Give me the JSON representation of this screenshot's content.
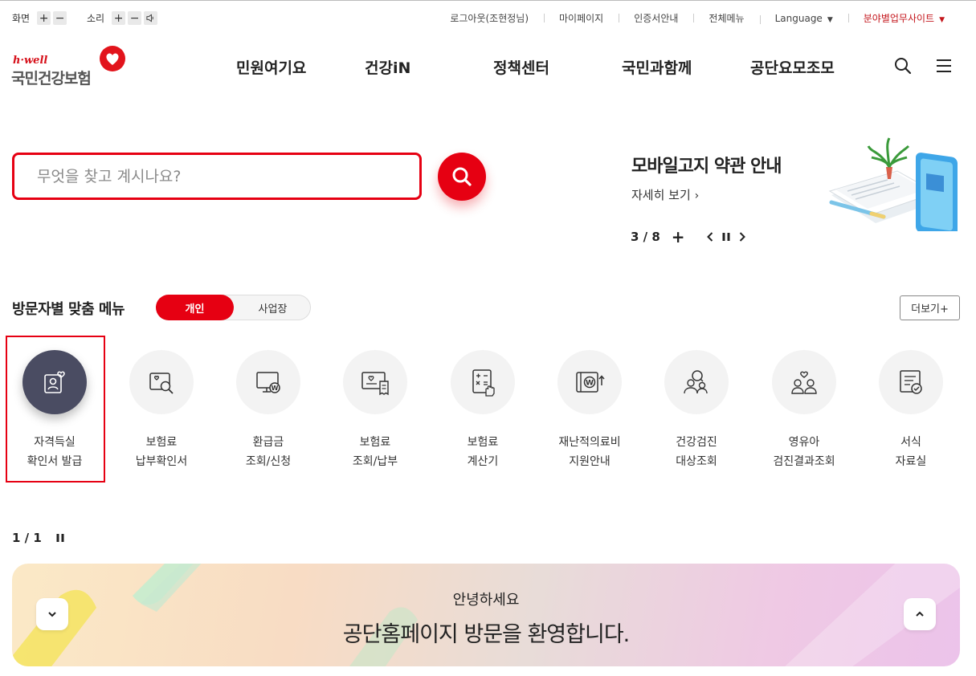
{
  "utility": {
    "screen_label": "화면",
    "sound_label": "소리",
    "plus": "+",
    "minus": "−",
    "links": [
      "로그아웃(조현정님)",
      "마이페이지",
      "인증서안내",
      "전체메뉴"
    ],
    "language": "Language",
    "business_site": "분야별업무사이트"
  },
  "header": {
    "logo_small": "h·well",
    "logo_name": "국민건강보험",
    "nav": [
      "민원여기요",
      "건강iN",
      "정책센터",
      "국민과함께",
      "공단요모조모"
    ],
    "icons": [
      "search-icon",
      "hamburger-menu-icon"
    ]
  },
  "search": {
    "placeholder": "무엇을 찾고 계시나요?"
  },
  "banner": {
    "title": "모바일고지 약관 안내",
    "more": "자세히 보기",
    "page": "3 / 8",
    "plus": "+"
  },
  "visitor_menu": {
    "title": "방문자별 맞춤 메뉴",
    "toggle_on": "개인",
    "toggle_off": "사업장",
    "more": "더보기+",
    "items": [
      {
        "l1": "자격득실",
        "l2": "확인서 발급",
        "icon": "certificate-person-icon"
      },
      {
        "l1": "보험료",
        "l2": "납부확인서",
        "icon": "document-search-icon"
      },
      {
        "l1": "환급금",
        "l2": "조회/신청",
        "icon": "monitor-won-icon"
      },
      {
        "l1": "보험료",
        "l2": "조회/납부",
        "icon": "receipt-icon"
      },
      {
        "l1": "보험료",
        "l2": "계산기",
        "icon": "calculator-icon"
      },
      {
        "l1": "재난적의료비",
        "l2": "지원안내",
        "icon": "won-support-icon"
      },
      {
        "l1": "건강검진",
        "l2": "대상조회",
        "icon": "people-search-icon"
      },
      {
        "l1": "영유아",
        "l2": "검진결과조회",
        "icon": "family-heart-icon"
      },
      {
        "l1": "서식",
        "l2": "자료실",
        "icon": "form-document-icon"
      }
    ],
    "page": "1 / 1"
  },
  "welcome": {
    "line1": "안녕하세요",
    "line2": "공단홈페이지 방문을 환영합니다."
  },
  "colors": {
    "brand_red": "#e60012",
    "dark_icon_bg": "#4a4c62"
  }
}
